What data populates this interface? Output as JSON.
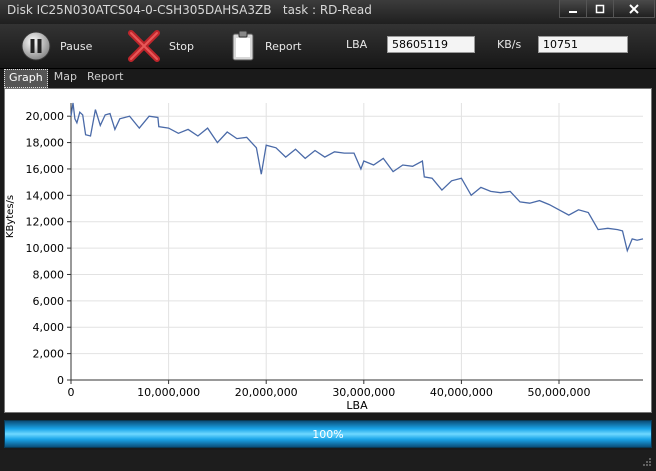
{
  "window": {
    "title": "Disk IC25N030ATCS04-0-CSH305DAHSA3ZB   task : RD-Read"
  },
  "toolbar": {
    "pause_label": "Pause",
    "stop_label": "Stop",
    "report_label": "Report",
    "lba_label": "LBA",
    "lba_value": "58605119",
    "kbs_label": "KB/s",
    "kbs_value": "10751"
  },
  "tabs": [
    {
      "label": "Graph",
      "active": true
    },
    {
      "label": "Map",
      "active": false
    },
    {
      "label": "Report",
      "active": false
    }
  ],
  "progress": {
    "text": "100%",
    "fraction": 1.0
  },
  "colors": {
    "series": "#4a6aa8",
    "progress": "#1aa4e8"
  },
  "chart_data": {
    "type": "line",
    "title": "",
    "xlabel": "LBA",
    "ylabel": "KBytes/s",
    "xlim": [
      0,
      58605119
    ],
    "ylim": [
      0,
      21000
    ],
    "grid": true,
    "x_ticks": [
      0,
      10000000,
      20000000,
      30000000,
      40000000,
      50000000
    ],
    "x_tick_labels": [
      "0",
      "10,000,000",
      "20,000,000",
      "30,000,000",
      "40,000,000",
      "50,000,000"
    ],
    "y_ticks": [
      0,
      2000,
      4000,
      6000,
      8000,
      10000,
      12000,
      14000,
      16000,
      18000,
      20000
    ],
    "y_tick_labels": [
      "0",
      "2,000",
      "4,000",
      "6,000",
      "8,000",
      "10,000",
      "12,000",
      "14,000",
      "16,000",
      "18,000",
      "20,000"
    ],
    "series": [
      {
        "x": [
          0,
          200000,
          400000,
          600000,
          900000,
          1200000,
          1500000,
          2000000,
          2500000,
          3000000,
          3500000,
          4000000,
          4500000,
          5000000,
          5500000,
          6000000,
          7000000,
          8000000,
          8900000,
          9000000,
          10000000,
          11000000,
          12000000,
          13000000,
          14000000,
          15000000,
          16000000,
          17000000,
          18000000,
          19000000,
          19500000,
          20000000,
          21000000,
          22000000,
          23000000,
          24000000,
          25000000,
          26000000,
          27000000,
          28000000,
          29000000,
          29700000,
          30000000,
          31000000,
          32000000,
          33000000,
          34000000,
          35000000,
          36000000,
          36200000,
          37000000,
          38000000,
          39000000,
          40000000,
          41000000,
          42000000,
          43000000,
          44000000,
          45000000,
          46000000,
          47000000,
          48000000,
          49000000,
          50000000,
          51000000,
          52000000,
          53000000,
          54000000,
          55000000,
          56000000,
          56500000,
          57000000,
          57500000,
          58000000,
          58605119
        ],
        "y": [
          20000,
          21000,
          19800,
          19500,
          20300,
          20100,
          18600,
          18500,
          20500,
          19300,
          20100,
          20200,
          19000,
          19800,
          19900,
          20000,
          19100,
          20000,
          19900,
          19200,
          19100,
          18700,
          19000,
          18500,
          19100,
          18000,
          18800,
          18300,
          18400,
          17600,
          15600,
          17800,
          17600,
          16900,
          17500,
          16800,
          17400,
          16900,
          17300,
          17200,
          17200,
          16000,
          16600,
          16300,
          16800,
          15800,
          16300,
          16200,
          16600,
          15400,
          15300,
          14400,
          15100,
          15300,
          14000,
          14600,
          14300,
          14200,
          14300,
          13500,
          13400,
          13600,
          13300,
          12900,
          12500,
          12900,
          12700,
          11400,
          11500,
          11400,
          11300,
          9800,
          10700,
          10600,
          10700
        ]
      }
    ]
  }
}
